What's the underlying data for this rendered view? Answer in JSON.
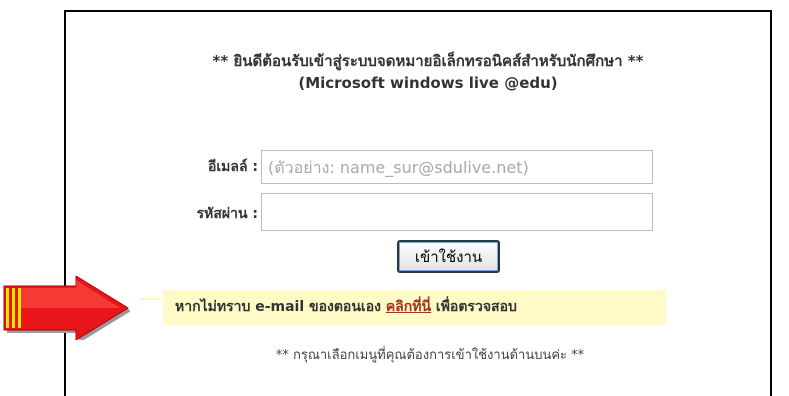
{
  "header": {
    "welcome_line1": "** ยินดีต้อนรับเข้าสู่ระบบจดหมายอิเล็กทรอนิคส์สำหรับนักศึกษา **",
    "welcome_line2": "(Microsoft windows live @edu)"
  },
  "form": {
    "email_label": "อีเมลล์ :",
    "email_placeholder": "(ตัวอย่าง: name_sur@sdulive.net)",
    "email_value": "",
    "password_label": "รหัสผ่าน :",
    "password_value": "",
    "login_button": "เข้าใช้งาน"
  },
  "hint": {
    "text_before": "หากไม่ทราบ e-mail ของตอนเอง ",
    "link_text": "คลิกที่นี่",
    "text_after": " เพื่อตรวจสอบ"
  },
  "footer": {
    "note": "** กรุณาเลือกเมนูที่คุณต้องการเข้าใช้งานด้านบนค่ะ **"
  },
  "colors": {
    "hint_background": "#fffac6",
    "link": "#a3361a",
    "arrow_red": "#e8151a",
    "arrow_yellow": "#ffe600"
  },
  "icons": {
    "arrow": "right-arrow-icon"
  }
}
